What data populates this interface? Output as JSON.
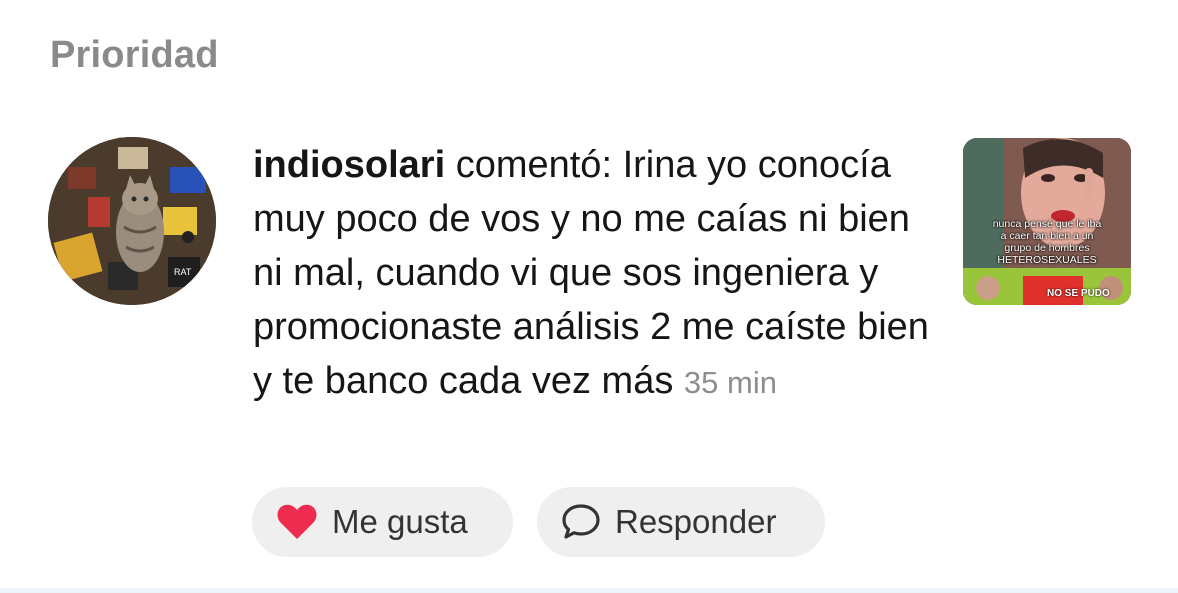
{
  "section": {
    "title": "Prioridad"
  },
  "notification": {
    "username": "indiosolari",
    "action": " comentó: ",
    "comment_text": "Irina yo conocía muy poco de vos y no me caías ni bien ni mal, cuando vi que sos ingeniera y promocionaste análisis 2 me caíste bien y te banco cada vez más",
    "timestamp": "35 min",
    "avatar_icon": "cat-with-guitar-pedals-photo",
    "thumbnail": {
      "caption": "nunca pensé que le iba\na caer tan bien a un\ngrupo de hombres\nHETEROSEXUALES",
      "banner": "NO SE PUDO"
    }
  },
  "actions": {
    "like_label": "Me gusta",
    "reply_label": "Responder",
    "like_icon": "heart-icon",
    "reply_icon": "speech-bubble-icon",
    "like_color": "#ee2c4f"
  }
}
